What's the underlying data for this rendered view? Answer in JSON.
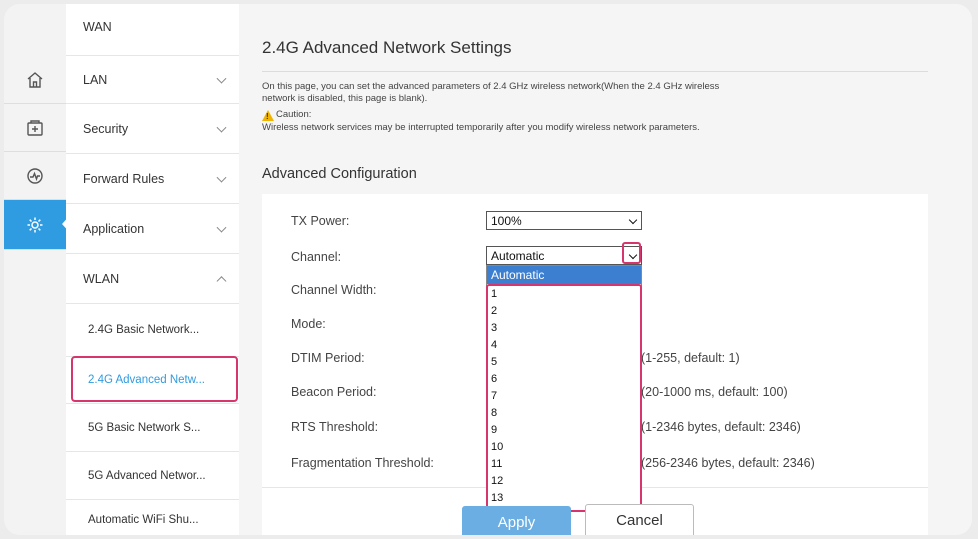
{
  "sidebar": {
    "icons": [
      {
        "name": "home-icon"
      },
      {
        "name": "security-plus-icon"
      },
      {
        "name": "forward-rules-icon"
      },
      {
        "name": "settings-gear-icon",
        "active": true
      }
    ],
    "menu": [
      {
        "label": "WAN"
      },
      {
        "label": "LAN"
      },
      {
        "label": "Security"
      },
      {
        "label": "Forward Rules"
      },
      {
        "label": "Application"
      },
      {
        "label": "WLAN",
        "expanded": true
      }
    ],
    "submenu": [
      {
        "label": "2.4G Basic Network..."
      },
      {
        "label": "2.4G Advanced Netw...",
        "active": true
      },
      {
        "label": "5G Basic Network S..."
      },
      {
        "label": "5G Advanced Networ..."
      },
      {
        "label": "Automatic WiFi Shu..."
      }
    ]
  },
  "page": {
    "title": "2.4G Advanced Network Settings",
    "description_1": "On this page, you can set the advanced parameters of 2.4 GHz wireless network(When the 2.4 GHz wireless",
    "description_2": "network is disabled, this page is blank).",
    "caution_label": "Caution:",
    "caution_text": "Wireless network services may be interrupted temporarily after you modify wireless network parameters.",
    "section_title": "Advanced Configuration"
  },
  "form": {
    "tx_power_label": "TX Power:",
    "tx_power_value": "100%",
    "channel_label": "Channel:",
    "channel_value": "Automatic",
    "channel_width_label": "Channel Width:",
    "mode_label": "Mode:",
    "dtim_label": "DTIM Period:",
    "dtim_hint": "(1-255, default: 1)",
    "beacon_label": "Beacon Period:",
    "beacon_hint": "(20-1000 ms, default: 100)",
    "rts_label": "RTS Threshold:",
    "rts_hint": "(1-2346 bytes, default: 2346)",
    "frag_label": "Fragmentation Threshold:",
    "frag_hint": "(256-2346 bytes, default: 2346)"
  },
  "channel_dropdown": {
    "selected": "Automatic",
    "options": [
      "1",
      "2",
      "3",
      "4",
      "5",
      "6",
      "7",
      "8",
      "9",
      "10",
      "11",
      "12",
      "13"
    ]
  },
  "buttons": {
    "apply": "Apply",
    "cancel": "Cancel"
  },
  "colors": {
    "accent": "#2f9be0",
    "highlight": "#d6356e",
    "apply_button": "#6aaee3"
  }
}
